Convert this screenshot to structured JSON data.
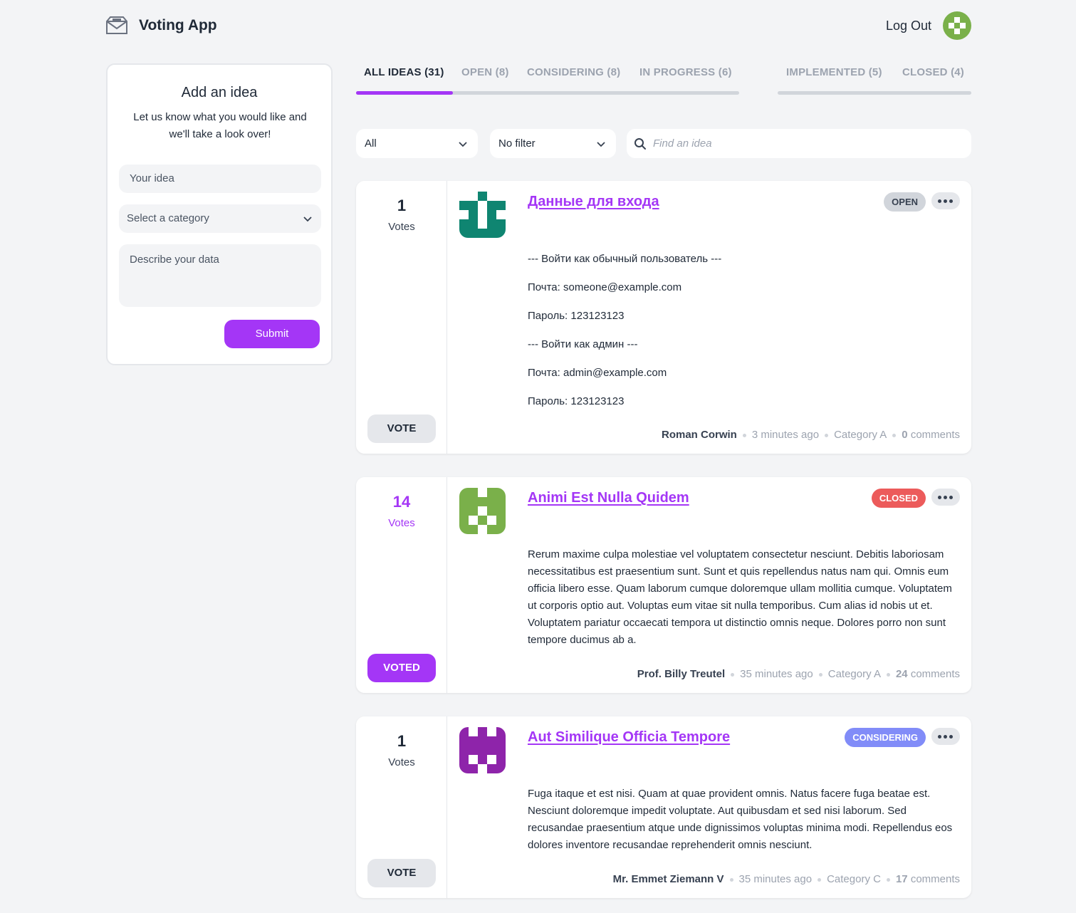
{
  "app": {
    "title": "Voting App",
    "logout_label": "Log Out"
  },
  "add_idea": {
    "title": "Add an idea",
    "subtitle": "Let us know what you would like and we'll take a look over!",
    "idea_placeholder": "Your idea",
    "category_placeholder": "Select a category",
    "description_placeholder": "Describe your data",
    "submit_label": "Submit"
  },
  "tabs": [
    {
      "label": "ALL IDEAS (31)",
      "active": true
    },
    {
      "label": "OPEN (8)"
    },
    {
      "label": "CONSIDERING (8)"
    },
    {
      "label": "IN PROGRESS (6)"
    },
    {
      "label": "IMPLEMENTED (5)"
    },
    {
      "label": "CLOSED (4)"
    }
  ],
  "filters": {
    "category_value": "All",
    "other_value": "No filter",
    "search_placeholder": "Find an idea"
  },
  "ideas": [
    {
      "votes": "1",
      "votes_label": "Votes",
      "vote_button": "VOTE",
      "voted": false,
      "title": "Данные для входа",
      "status": "OPEN",
      "status_color": "#d1d5db",
      "body": [
        "--- Войти как обычный пользователь ---",
        "Почта: someone@example.com",
        "Пароль: 123123123",
        "--- Войти как админ ---",
        "Почта: admin@example.com",
        "Пароль: 123123123"
      ],
      "author": "Roman Corwin",
      "time": "3 minutes ago",
      "category": "Category A",
      "comments_count": "0",
      "comments_label": "comments",
      "avatar_color": "#0f8571"
    },
    {
      "votes": "14",
      "votes_label": "Votes",
      "vote_button": "VOTED",
      "voted": true,
      "title": "Animi Est Nulla Quidem",
      "status": "CLOSED",
      "status_color": "#ec5b5b",
      "body": [
        "Rerum maxime culpa molestiae vel voluptatem consectetur nesciunt. Debitis laboriosam necessitatibus est praesentium sunt. Sunt et quis repellendus natus nam qui. Omnis eum officia libero esse. Quam laborum cumque doloremque ullam mollitia cumque. Voluptatem ut corporis optio aut. Voluptas eum vitae sit nulla temporibus. Cum alias id nobis ut et. Voluptatem pariatur occaecati tempora ut distinctio omnis neque. Dolores porro non sunt tempore ducimus ab a."
      ],
      "author": "Prof. Billy Treutel",
      "time": "35 minutes ago",
      "category": "Category A",
      "comments_count": "24",
      "comments_label": "comments",
      "avatar_color": "#7ab04a"
    },
    {
      "votes": "1",
      "votes_label": "Votes",
      "vote_button": "VOTE",
      "voted": false,
      "title": "Aut Similique Officia Tempore",
      "status": "CONSIDERING",
      "status_color": "#818cf8",
      "body": [
        "Fuga itaque et est nisi. Quam at quae provident omnis. Natus facere fuga beatae est. Nesciunt doloremque impedit voluptate. Aut quibusdam et sed nisi laborum. Sed recusandae praesentium atque unde dignissimos voluptas minima modi. Repellendus eos dolores inventore recusandae reprehenderit omnis nesciunt."
      ],
      "author": "Mr. Emmet Ziemann V",
      "time": "35 minutes ago",
      "category": "Category C",
      "comments_count": "17",
      "comments_label": "comments",
      "avatar_color": "#8e24aa"
    }
  ],
  "colors": {
    "accent": "#a436f6",
    "background": "#f3f4f6",
    "user_avatar": "#7ab04a"
  }
}
